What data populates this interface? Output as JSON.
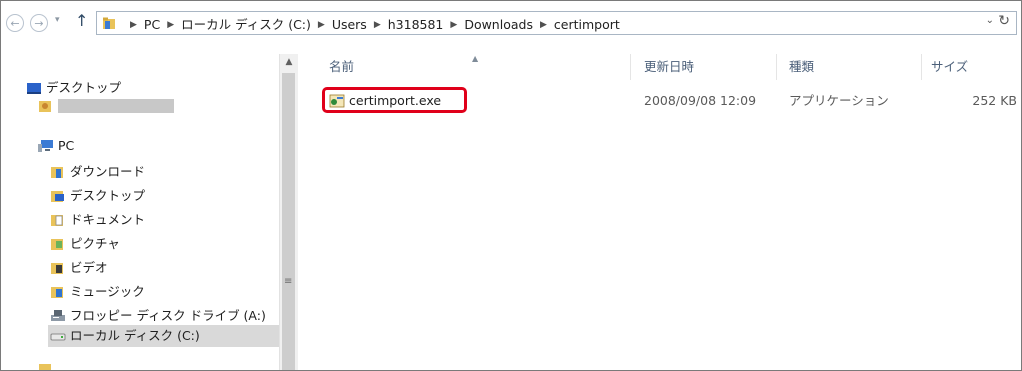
{
  "address_bar": {
    "recent_locations": "▾",
    "path": [
      "PC",
      "ローカル ディスク (C:)",
      "Users",
      "h318581",
      "Downloads",
      "certimport"
    ],
    "dropdown": "⌄",
    "refresh": "↻"
  },
  "navigation": {
    "back": "←",
    "forward": "→",
    "up": "↑"
  },
  "sidebar": {
    "items": [
      {
        "label": "デスクトップ"
      },
      {
        "label": ""
      },
      {
        "label": "PC"
      },
      {
        "label": "ダウンロード"
      },
      {
        "label": "デスクトップ"
      },
      {
        "label": "ドキュメント"
      },
      {
        "label": "ピクチャ"
      },
      {
        "label": "ビデオ"
      },
      {
        "label": "ミュージック"
      },
      {
        "label": "フロッピー ディスク ドライブ (A:)"
      },
      {
        "label": "ローカル ディスク (C:)"
      }
    ],
    "scroll_up": "▲",
    "scroll_grip": "≡"
  },
  "file_list": {
    "columns": {
      "name": "名前",
      "date": "更新日時",
      "type": "種類",
      "size": "サイズ"
    },
    "sort_indicator": "▲",
    "rows": [
      {
        "name": "certimport.exe",
        "date": "2008/09/08 12:09",
        "type": "アプリケーション",
        "size": "252 KB",
        "highlighted": true
      }
    ]
  },
  "colors": {
    "highlight": "#e0001a",
    "header_text": "#4c607a",
    "selected_row": "#d9d9d9"
  }
}
